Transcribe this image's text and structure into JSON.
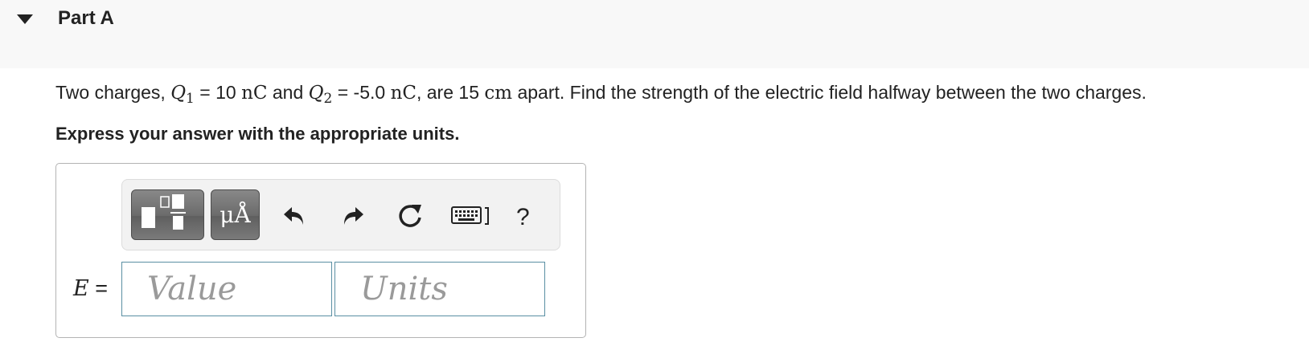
{
  "part": {
    "title": "Part A"
  },
  "question": {
    "p1": "Two charges, ",
    "q1_symbol": "Q",
    "q1_sub": "1",
    "p2": " = 10 ",
    "q1_unit": "nC",
    "p3": " and ",
    "q2_symbol": "Q",
    "q2_sub": "2",
    "p4": " = -5.0 ",
    "q2_unit": "nC",
    "p5": ", are 15 ",
    "dist_unit": "cm",
    "p6": " apart. Find the strength of the electric field halfway between the two charges."
  },
  "instruction": "Express your answer with the appropriate units.",
  "toolbar": {
    "symbols_label": "μÅ",
    "help_label": "?",
    "icons": [
      "templates-icon",
      "undo-icon",
      "redo-icon",
      "reset-icon",
      "keyboard-icon"
    ]
  },
  "answer": {
    "variable": "E",
    "equals": " =",
    "value_placeholder": "Value",
    "units_placeholder": "Units"
  },
  "colors": {
    "header_bg": "#f8f8f8",
    "field_border": "#5a8fa3",
    "button_gray": "#6b6b6b"
  }
}
